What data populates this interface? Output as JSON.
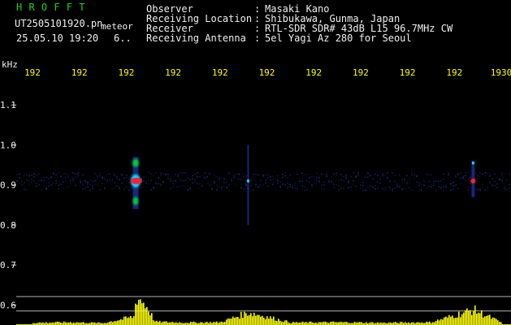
{
  "header": {
    "title": "H R O F F T",
    "filename": "UT2505101920.pn",
    "tag": "meteor",
    "datetime": "25.05.10 19:20",
    "extra": "6..",
    "fields": [
      {
        "label": "Observer",
        "sep": ":",
        "value": "Masaki Kano"
      },
      {
        "label": "Receiving Location",
        "sep": ":",
        "value": "Shibukawa, Gunma, Japan"
      },
      {
        "label": "Receiver",
        "sep": ":",
        "value": "RTL-SDR SDR# 43dB L15 96.7MHz CW"
      },
      {
        "label": "Receiving Antenna",
        "sep": ":",
        "value": "5el Yagi Az 280 for Seoul"
      }
    ]
  },
  "colors": {
    "background": "#000000",
    "header_text": "#f0f0f0",
    "title_text": "#1ed21e",
    "time_labels": "#ffff00",
    "signal_red": "#ff2040",
    "signal_cyan": "#00e0ff",
    "signal_green": "#00c840",
    "noise_blue": "#1a2a88",
    "echo_yellow": "#ffff00"
  },
  "chart_data": {
    "type": "heatmap",
    "ylabel": "kHz",
    "ylim": [
      0.55,
      1.2
    ],
    "yticks": [
      0.6,
      0.7,
      0.8,
      0.9,
      1.0,
      1.1
    ],
    "ytick_labels": [
      "0.6",
      "0.7",
      "0.8",
      "0.9",
      "1.0",
      "1.1"
    ],
    "xlim": [
      1920,
      1930
    ],
    "x_ticks": [
      1920,
      1921,
      1922,
      1923,
      1924,
      1925,
      1926,
      1927,
      1928,
      1929,
      1930
    ],
    "x_tick_labels": [
      "192",
      "192",
      "192",
      "192",
      "192",
      "192",
      "192",
      "192",
      "192",
      "192",
      "1930"
    ],
    "carrier_freq_khz": 0.91,
    "meteor_echoes": [
      {
        "time": 1922.2,
        "freq_low": 0.84,
        "freq_high": 0.97,
        "intensity": "strong"
      },
      {
        "time": 1924.6,
        "freq_low": 0.8,
        "freq_high": 1.0,
        "intensity": "weak"
      },
      {
        "time": 1929.4,
        "freq_low": 0.87,
        "freq_high": 0.96,
        "intensity": "medium"
      }
    ],
    "reference_lines_khz": [
      0.621,
      0.585
    ],
    "amplitude_profile": [
      {
        "time": 1920.0,
        "level": 0.08
      },
      {
        "time": 1920.8,
        "level": 0.1
      },
      {
        "time": 1921.5,
        "level": 0.07
      },
      {
        "time": 1922.15,
        "level": 0.3
      },
      {
        "time": 1922.2,
        "level": 1.0
      },
      {
        "time": 1922.3,
        "level": 0.9
      },
      {
        "time": 1922.45,
        "level": 0.6
      },
      {
        "time": 1922.6,
        "level": 0.12
      },
      {
        "time": 1923.2,
        "level": 0.09
      },
      {
        "time": 1924.0,
        "level": 0.1
      },
      {
        "time": 1924.6,
        "level": 0.45
      },
      {
        "time": 1925.5,
        "level": 0.09
      },
      {
        "time": 1926.5,
        "level": 0.1
      },
      {
        "time": 1927.5,
        "level": 0.08
      },
      {
        "time": 1928.5,
        "level": 0.1
      },
      {
        "time": 1929.4,
        "level": 0.55
      },
      {
        "time": 1930.0,
        "level": 0.08
      }
    ]
  }
}
